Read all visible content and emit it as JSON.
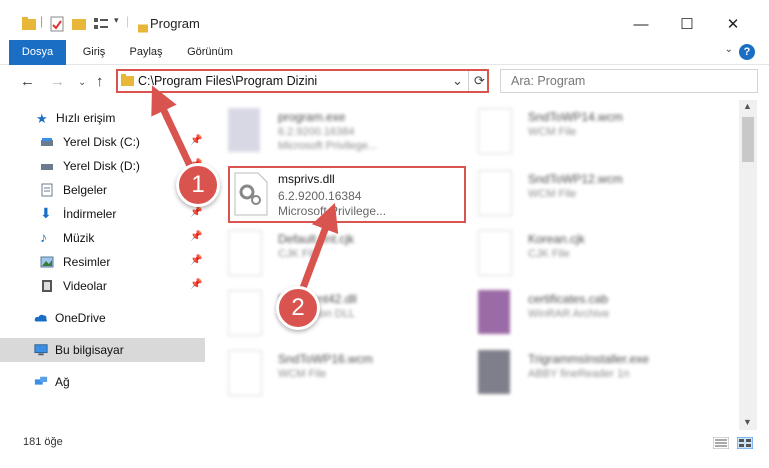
{
  "window": {
    "title": "Program",
    "minimize": "—",
    "maximize": "☐",
    "close": "✕"
  },
  "ribbon": {
    "tabs": [
      "Dosya",
      "Giriş",
      "Paylaş",
      "Görünüm"
    ],
    "help": "?"
  },
  "nav": {
    "back": "←",
    "forward": "→",
    "up": "↑",
    "address": "C:\\Program Files\\Program Dizini",
    "address_dropdown": "⌄",
    "refresh": "⟳",
    "search_placeholder": "Ara: Program"
  },
  "sidebar": {
    "items": [
      {
        "label": "Hızlı erişim",
        "icon": "star-icon",
        "pinned": false
      },
      {
        "label": "Yerel Disk (C:)",
        "icon": "drive-icon",
        "pinned": true
      },
      {
        "label": "Yerel Disk (D:)",
        "icon": "drive-icon",
        "pinned": true
      },
      {
        "label": "Belgeler",
        "icon": "documents-icon",
        "pinned": true
      },
      {
        "label": "İndirmeler",
        "icon": "download-icon",
        "pinned": true
      },
      {
        "label": "Müzik",
        "icon": "music-icon",
        "pinned": true
      },
      {
        "label": "Resimler",
        "icon": "pictures-icon",
        "pinned": true
      },
      {
        "label": "Videolar",
        "icon": "video-icon",
        "pinned": true
      },
      {
        "label": "OneDrive",
        "icon": "cloud-icon",
        "pinned": false
      },
      {
        "label": "Bu bilgisayar",
        "icon": "computer-icon",
        "pinned": false
      },
      {
        "label": "Ağ",
        "icon": "network-icon",
        "pinned": false
      }
    ]
  },
  "files": [
    {
      "name": "program.exe",
      "meta1": "6.2.9200.16384",
      "meta2": "Microsoft Privilege..."
    },
    {
      "name": "SndToWP14.wcm",
      "meta1": "WCM File",
      "meta2": ""
    },
    {
      "name": "msprivs.dll",
      "meta1": "6.2.9200.16384",
      "meta2": "Microsoft Privilege..."
    },
    {
      "name": "SndToWP12.wcm",
      "meta1": "WCM File",
      "meta2": ""
    },
    {
      "name": "Default.ent.cjk",
      "meta1": "CJK File",
      "meta2": ""
    },
    {
      "name": "Korean.cjk",
      "meta1": "CJK File",
      "meta2": ""
    },
    {
      "name": "MsfClient42.dll",
      "meta1": "Application DLL",
      "meta2": ""
    },
    {
      "name": "certificates.cab",
      "meta1": "WinRAR Archive",
      "meta2": ""
    },
    {
      "name": "SndToWP16.wcm",
      "meta1": "WCM File",
      "meta2": ""
    },
    {
      "name": "TrigrammsInstaller.exe",
      "meta1": "ABBY fineReader 1n",
      "meta2": ""
    }
  ],
  "status": {
    "count": "181 öğe"
  },
  "annotations": {
    "step1": "1",
    "step2": "2"
  },
  "colors": {
    "accent": "#1a6fc4",
    "highlight": "#d9534f"
  }
}
